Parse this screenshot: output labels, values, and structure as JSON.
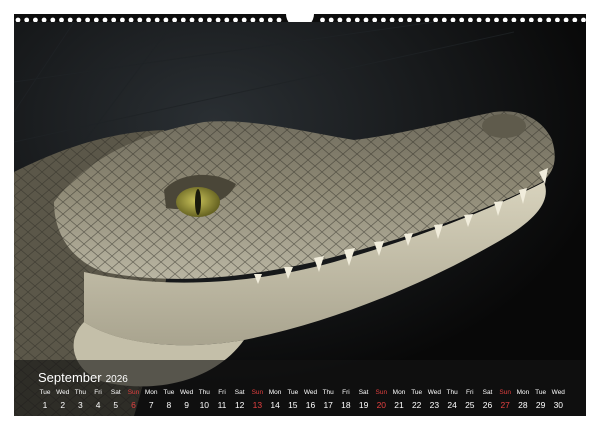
{
  "calendar": {
    "month": "September",
    "year": "2026",
    "days": [
      {
        "wd": "Tue",
        "d": "1"
      },
      {
        "wd": "Wed",
        "d": "2"
      },
      {
        "wd": "Thu",
        "d": "3"
      },
      {
        "wd": "Fri",
        "d": "4"
      },
      {
        "wd": "Sat",
        "d": "5"
      },
      {
        "wd": "Sun",
        "d": "6",
        "sun": true
      },
      {
        "wd": "Mon",
        "d": "7"
      },
      {
        "wd": "Tue",
        "d": "8"
      },
      {
        "wd": "Wed",
        "d": "9"
      },
      {
        "wd": "Thu",
        "d": "10"
      },
      {
        "wd": "Fri",
        "d": "11"
      },
      {
        "wd": "Sat",
        "d": "12"
      },
      {
        "wd": "Sun",
        "d": "13",
        "sun": true
      },
      {
        "wd": "Mon",
        "d": "14"
      },
      {
        "wd": "Tue",
        "d": "15"
      },
      {
        "wd": "Wed",
        "d": "16"
      },
      {
        "wd": "Thu",
        "d": "17"
      },
      {
        "wd": "Fri",
        "d": "18"
      },
      {
        "wd": "Sat",
        "d": "19"
      },
      {
        "wd": "Sun",
        "d": "20",
        "sun": true
      },
      {
        "wd": "Mon",
        "d": "21"
      },
      {
        "wd": "Tue",
        "d": "22"
      },
      {
        "wd": "Wed",
        "d": "23"
      },
      {
        "wd": "Thu",
        "d": "24"
      },
      {
        "wd": "Fri",
        "d": "25"
      },
      {
        "wd": "Sat",
        "d": "26"
      },
      {
        "wd": "Sun",
        "d": "27",
        "sun": true
      },
      {
        "wd": "Mon",
        "d": "28"
      },
      {
        "wd": "Tue",
        "d": "29"
      },
      {
        "wd": "Wed",
        "d": "30"
      }
    ]
  },
  "colors": {
    "sunday": "#e34040",
    "text": "#ffffff"
  },
  "icons": {
    "binding": "spiral-binding-icon",
    "hanger": "hanger-hole-icon"
  }
}
